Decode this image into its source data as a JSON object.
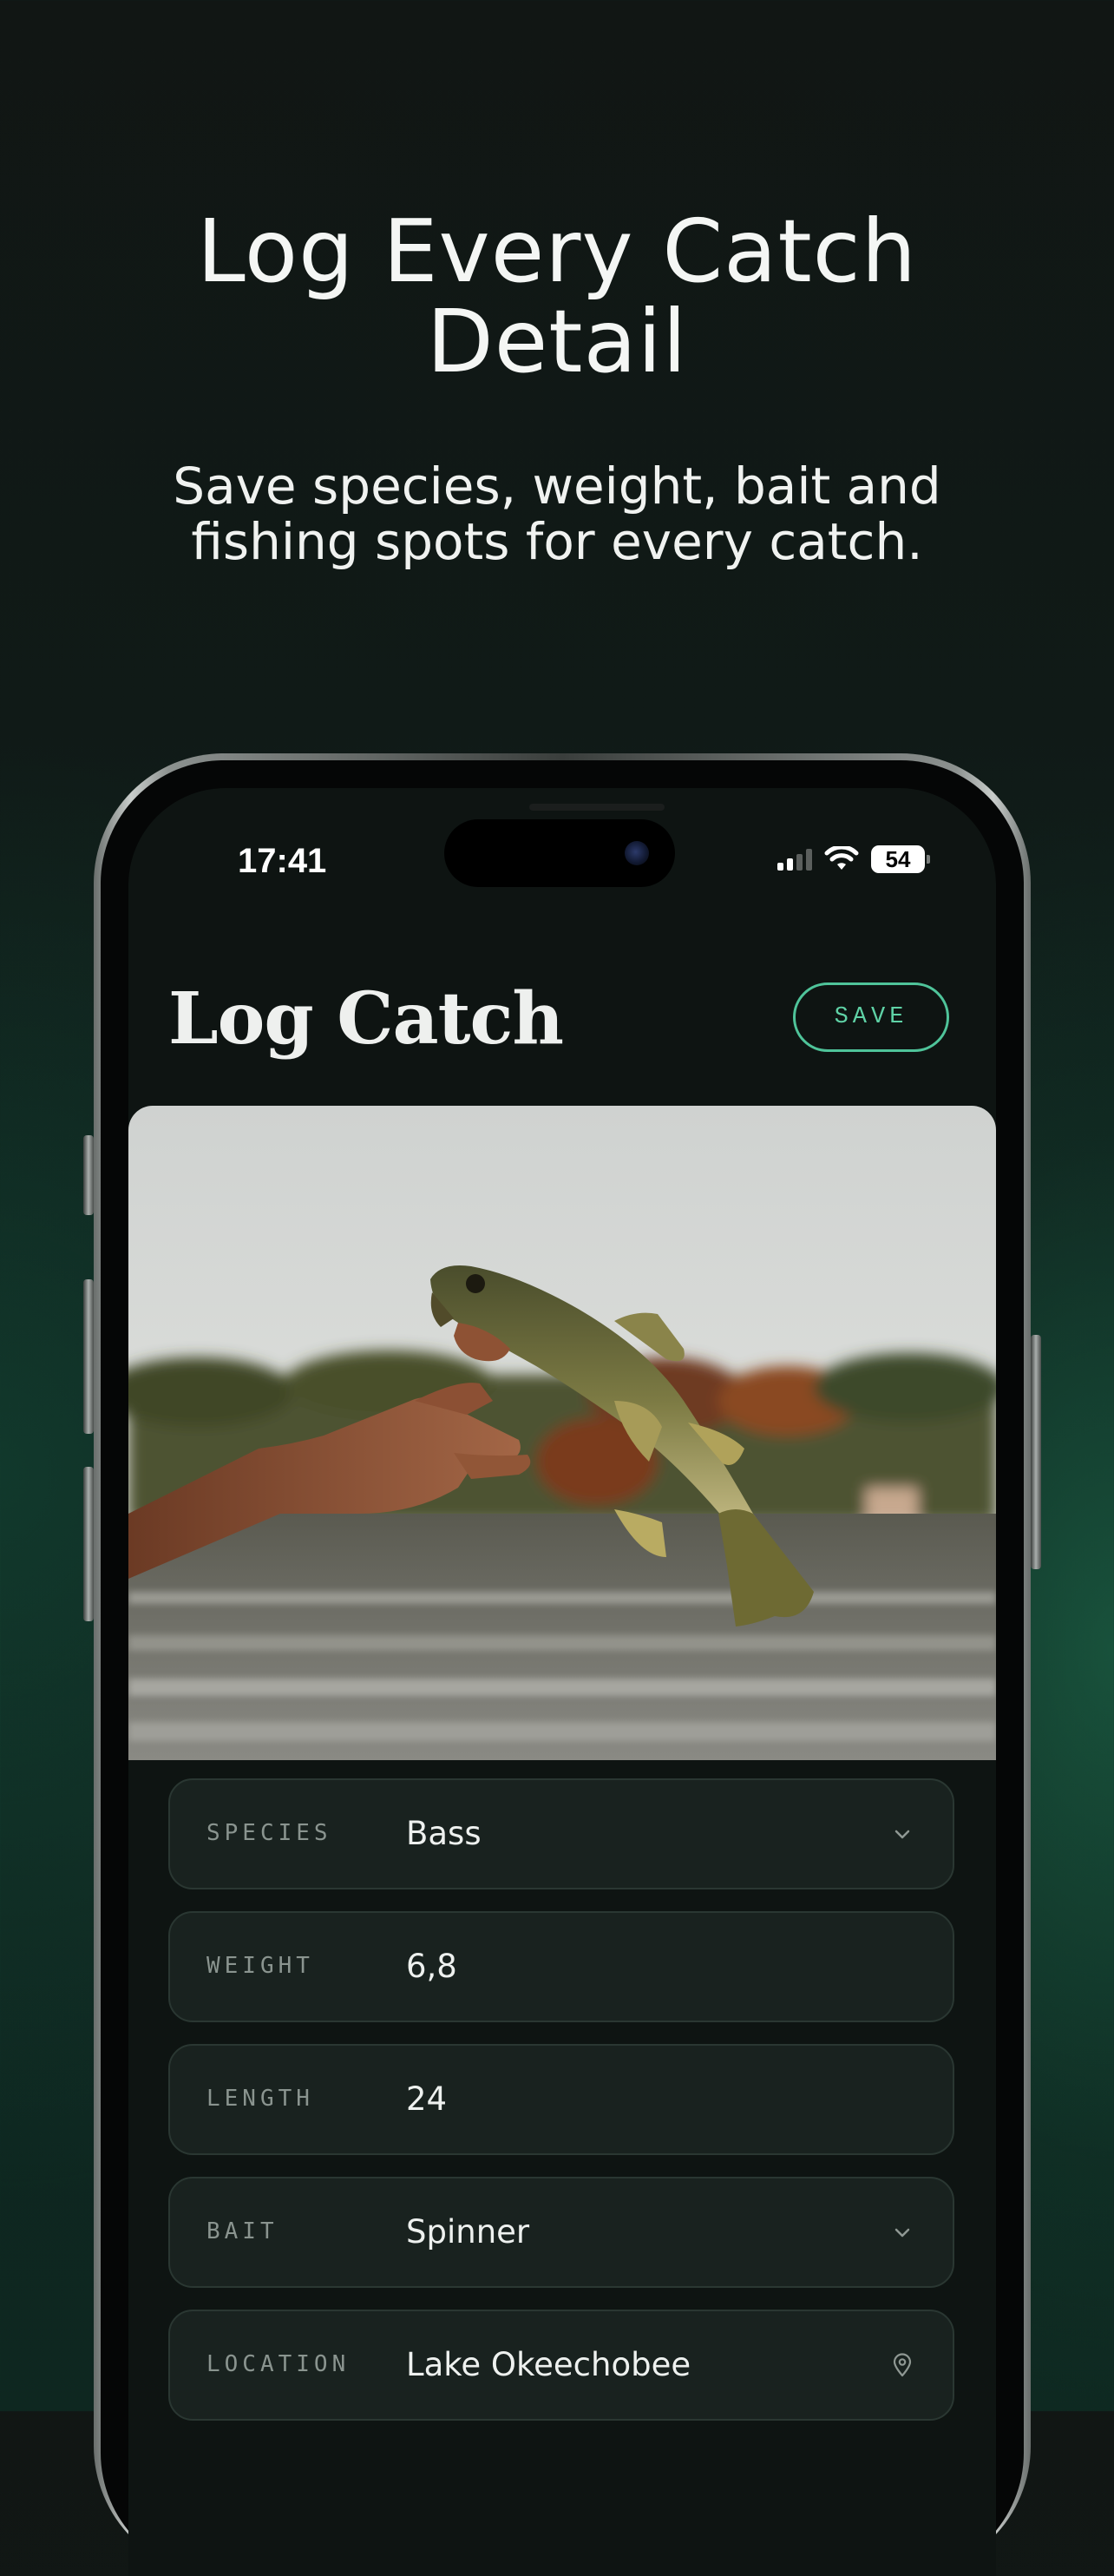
{
  "promo": {
    "title_line1": "Log Every Catch",
    "title_line2": "Detail",
    "subtitle_line1": "Save species, weight, bait and",
    "subtitle_line2": "fishing spots for every catch."
  },
  "status_bar": {
    "time": "17:41",
    "battery": "54",
    "icons": [
      "signal-icon",
      "wifi-icon",
      "battery-icon"
    ]
  },
  "app": {
    "title": "Log Catch",
    "save_label": "SAVE",
    "accent_color": "#4fc49a",
    "photo": {
      "icon": "catch-photo",
      "subject": "largemouth-bass-held-by-hand"
    }
  },
  "form": {
    "fields": [
      {
        "label": "SPECIES",
        "value": "Bass",
        "icon": "chevron-down-icon"
      },
      {
        "label": "WEIGHT",
        "value": "6,8"
      },
      {
        "label": "LENGTH",
        "value": "24"
      },
      {
        "label": "BAIT",
        "value": "Spinner",
        "icon": "chevron-down-icon"
      },
      {
        "label": "LOCATION",
        "value": "Lake Okeechobee",
        "icon": "map-pin-icon"
      }
    ]
  }
}
